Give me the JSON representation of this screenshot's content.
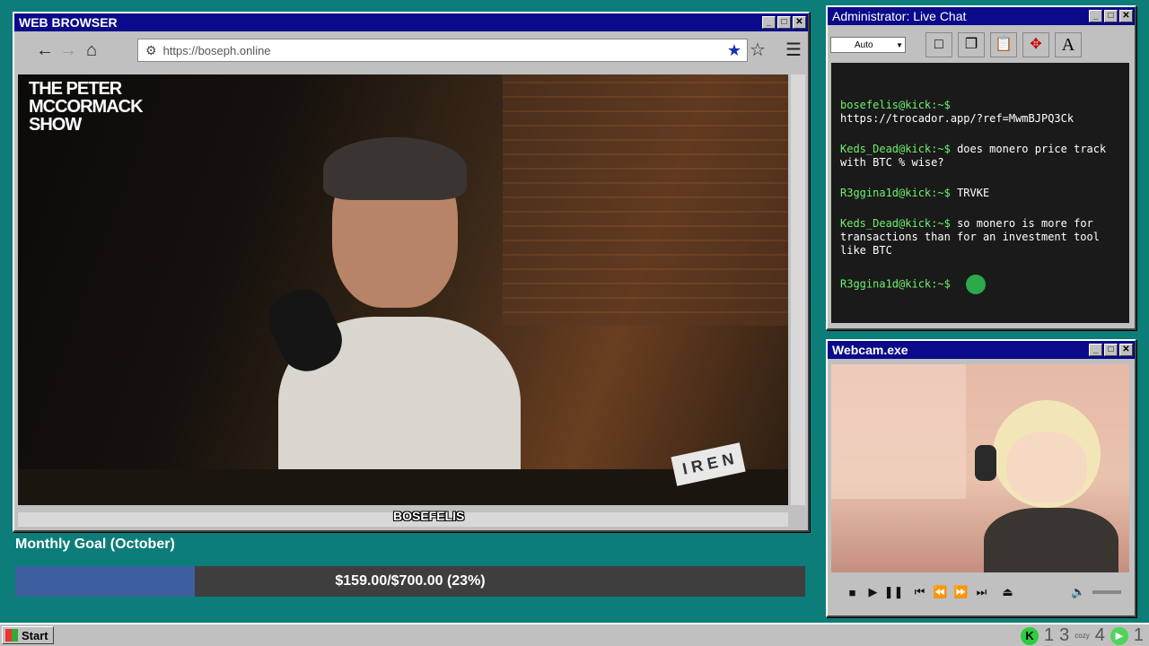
{
  "browser": {
    "title": "WEB BROWSER",
    "url": "https://boseph.online",
    "video": {
      "show_logo": "THE PETER MCCORMACK SHOW",
      "sponsor_logo": "I R E N",
      "caption": "BOSEFELIS"
    }
  },
  "chat": {
    "title": "Administrator: Live Chat",
    "font_select": "Auto",
    "messages": [
      {
        "user": "bosefelis@kick:~$",
        "text": "https://trocador.app/?ref=MwmBJPQ3Ck"
      },
      {
        "user": "Keds_Dead@kick:~$",
        "text": "does monero price track with BTC % wise?"
      },
      {
        "user": "R3ggina1d@kick:~$",
        "text": "TRVKE"
      },
      {
        "user": "Keds_Dead@kick:~$",
        "text": "so monero is more for transactions than for an investment tool like BTC"
      },
      {
        "user": "R3ggina1d@kick:~$",
        "text": ""
      }
    ]
  },
  "webcam": {
    "title": "Webcam.exe"
  },
  "goal": {
    "title": "Monthly Goal (October)",
    "text": "$159.00/$700.00 (23%)",
    "progress_fraction": 0.227
  },
  "taskbar": {
    "start_label": "Start",
    "tray_numbers": [
      "1",
      "3",
      "4",
      "1"
    ],
    "tray_small_label": "cozy"
  },
  "colors": {
    "desktop": "#0c7d78",
    "titlebar": "#0a0a8a",
    "chat_user": "#6ef06e",
    "goal_fill": "#3d5fa0"
  }
}
